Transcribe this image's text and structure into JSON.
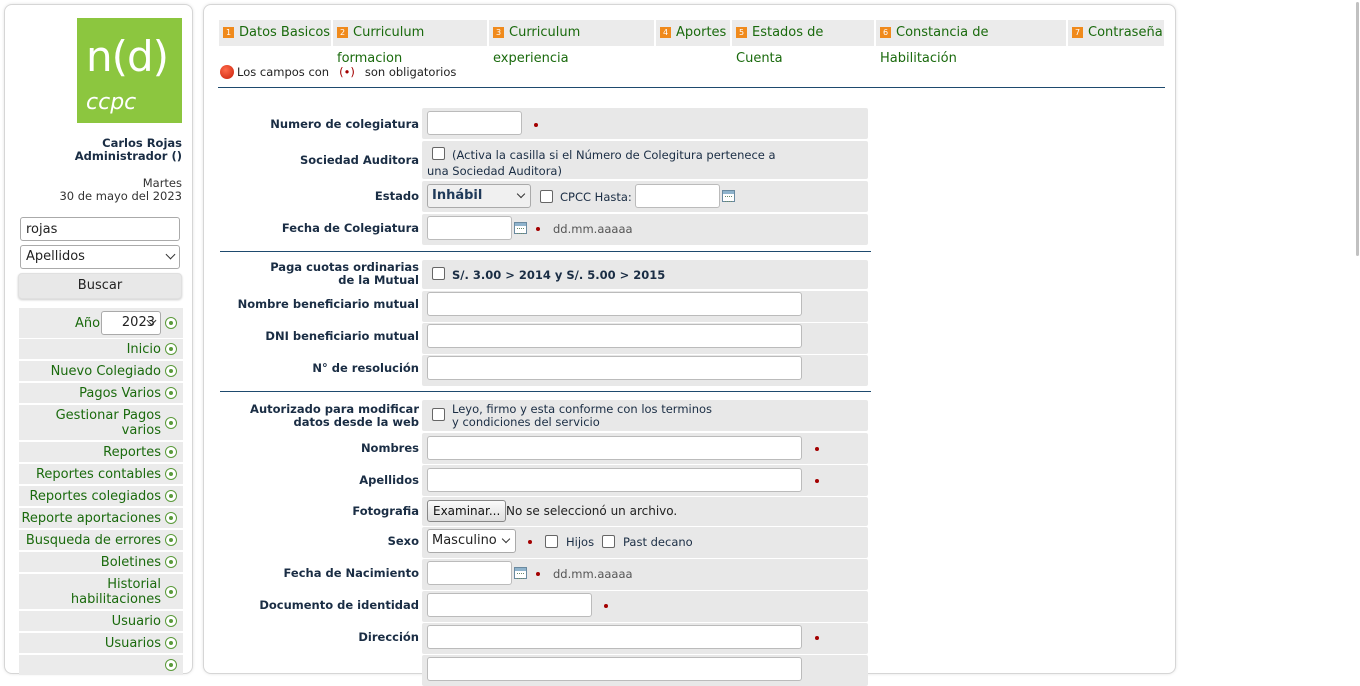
{
  "logo": {
    "line1": "n(d)",
    "line2": "ccpc"
  },
  "user": {
    "name": "Carlos Rojas",
    "role": "Administrador ()",
    "weekday": "Martes",
    "date": "30 de mayo del 2023"
  },
  "search": {
    "value": "rojas",
    "field": "Apellidos",
    "button": "Buscar"
  },
  "year": {
    "label": "Año",
    "value": "2023"
  },
  "nav": [
    "Inicio",
    "Nuevo Colegiado",
    "Pagos Varios",
    "Gestionar Pagos varios",
    "Reportes",
    "Reportes contables",
    "Reportes colegiados",
    "Reporte aportaciones",
    "Busqueda de errores",
    "Boletines",
    "Historial habilitaciones",
    "Usuario",
    "Usuarios"
  ],
  "nav_line1": {
    "gestionar": "Gestionar Pagos",
    "historial": "Historial"
  },
  "nav_line2": {
    "gestionar": "varios",
    "historial": "habilitaciones"
  },
  "tabs": [
    {
      "num": "1",
      "label": "Datos Basicos"
    },
    {
      "num": "2",
      "label": "Curriculum formacion"
    },
    {
      "num": "3",
      "label": "Curriculum experiencia"
    },
    {
      "num": "4",
      "label": "Aportes"
    },
    {
      "num": "5",
      "label": "Estados de Cuenta"
    },
    {
      "num": "6",
      "label": "Constancia de Habilitación"
    },
    {
      "num": "7",
      "label": "Contraseña"
    }
  ],
  "required_note": {
    "pre": "Los campos con",
    "mark": "(•)",
    "post": "son obligatorios"
  },
  "form": {
    "numero_colegiatura": "Numero de colegiatura",
    "sociedad_auditora": "Sociedad Auditora",
    "sociedad_hint_1": "(Activa la casilla si el Número de Colegitura pertenece a",
    "sociedad_hint_2": "una Sociedad Auditora)",
    "estado": "Estado",
    "estado_value": "Inhábil",
    "cpcc_hasta": "CPCC Hasta:",
    "fecha_colegiatura": "Fecha de Colegiatura",
    "date_hint": "dd.mm.aaaaa",
    "paga_cuotas_1": "Paga cuotas ordinarias",
    "paga_cuotas_2": "de la Mutual",
    "cuotas_text": "S/. 3.00 > 2014 y S/. 5.00 > 2015",
    "nombre_beneficiario": "Nombre beneficiario mutual",
    "dni_beneficiario": "DNI beneficiario mutual",
    "n_resolucion": "N° de resolución",
    "autorizado_1": "Autorizado para modificar",
    "autorizado_2": "datos desde la web",
    "autorizado_hint_1": "Leyo, firmo y esta conforme con los terminos",
    "autorizado_hint_2": "y condiciones del servicio",
    "nombres": "Nombres",
    "apellidos": "Apellidos",
    "fotografia": "Fotografia",
    "examinar": "Examinar...",
    "no_file": "No se seleccionó un archivo.",
    "sexo": "Sexo",
    "sexo_value": "Masculino",
    "hijos": "Hijos",
    "past_decano": "Past decano",
    "fecha_nacimiento": "Fecha de Nacimiento",
    "documento": "Documento de identidad",
    "direccion": "Dirección"
  }
}
